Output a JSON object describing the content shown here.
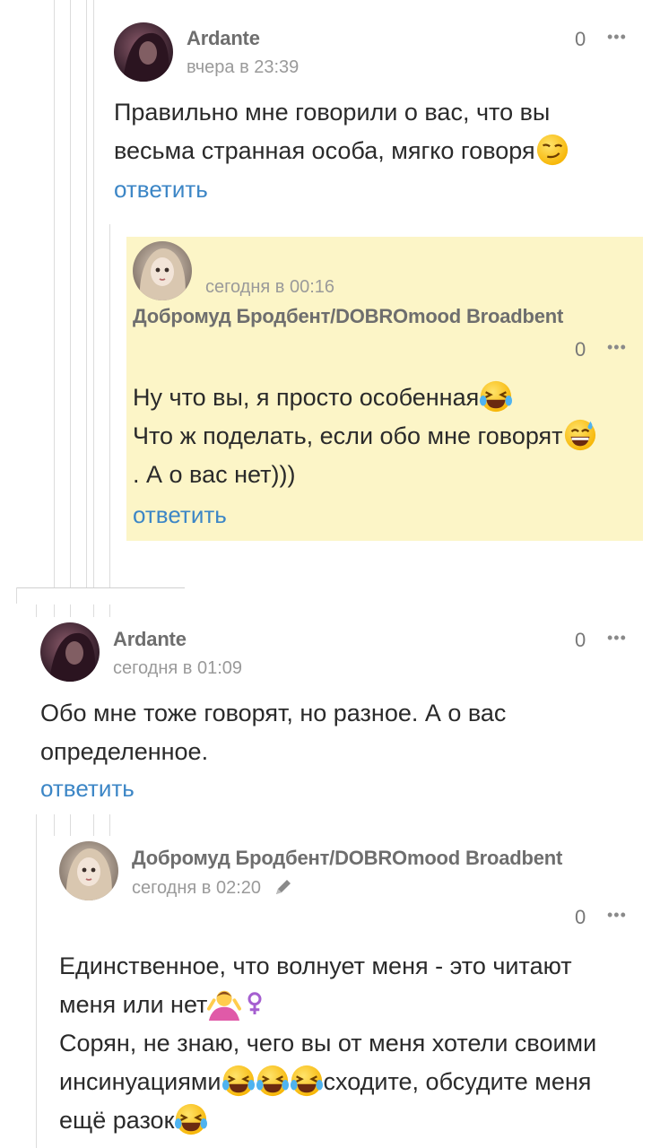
{
  "comments": [
    {
      "author": "Ardante",
      "time": "вчера в 23:39",
      "rating": "0",
      "lines": [
        "Правильно мне говорили о вас, что вы",
        "весьма странная особа, мягко говоря"
      ],
      "reply": "ответить"
    },
    {
      "author": "Добромуд Бродбент/DOBROmood Broadbent",
      "time": "сегодня в 00:16",
      "rating": "0",
      "lines": [
        "Ну что вы, я просто особенная",
        "Что ж поделать, если обо мне говорят",
        ". А о вас нет)))"
      ],
      "reply": "ответить"
    },
    {
      "author": "Ardante",
      "time": "сегодня в 01:09",
      "rating": "0",
      "lines": [
        "Обо мне тоже говорят, но разное. А о вас",
        "определенное."
      ],
      "reply": "ответить"
    },
    {
      "author": "Добромуд Бродбент/DOBROmood Broadbent",
      "time": "сегодня в 02:20",
      "rating": "0",
      "lines": [
        "Единственное, что волнует меня - это читают",
        "меня или нет",
        "Сорян, не знаю, чего вы от меня хотели своими",
        "инсинуациями",
        "сходите, обсудите меня",
        "ещё разок"
      ]
    }
  ],
  "more_icon": "•••",
  "icons": [
    "avatar-dark-hair",
    "avatar-doll",
    "smirk-emoji",
    "laughing-tears-emoji",
    "sweat-smile-emoji",
    "shrug-emoji",
    "female-sign-icon",
    "pencil-icon"
  ],
  "colors": {
    "link": "#3c86c6",
    "highlight": "#fcf5c7",
    "author": "#6e6e6e",
    "time": "#9a9a9a"
  }
}
